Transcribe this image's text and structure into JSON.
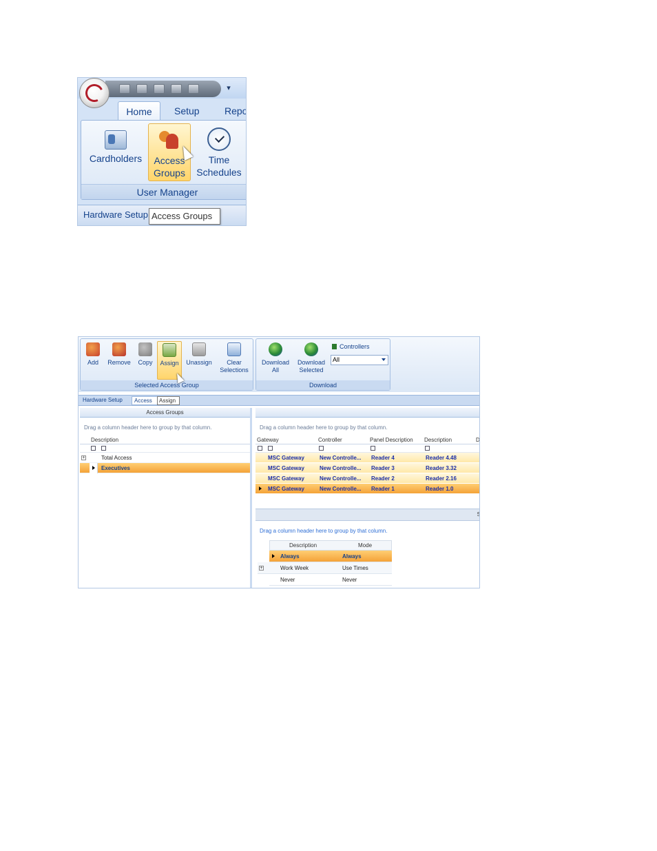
{
  "shot1": {
    "tabs": [
      "Home",
      "Setup",
      "Repo"
    ],
    "ribbon_buttons": [
      {
        "label_line1": "Cardholders",
        "label_line2": "",
        "icon": "cardholders-icon"
      },
      {
        "label_line1": "Access",
        "label_line2": "Groups",
        "icon": "people-icon"
      },
      {
        "label_line1": "Time",
        "label_line2": "Schedules",
        "icon": "clock-icon"
      }
    ],
    "group_label": "User Manager",
    "doc_tab": "Hardware Setup",
    "tooltip": "Access Groups"
  },
  "shot2": {
    "selected_group": {
      "label": "Selected Access Group",
      "buttons": [
        {
          "label_line1": "Add",
          "label_line2": ""
        },
        {
          "label_line1": "Remove",
          "label_line2": ""
        },
        {
          "label_line1": "Copy",
          "label_line2": ""
        },
        {
          "label_line1": "Assign",
          "label_line2": ""
        },
        {
          "label_line1": "Unassign",
          "label_line2": ""
        },
        {
          "label_line1": "Clear",
          "label_line2": "Selections"
        }
      ]
    },
    "download_group": {
      "label": "Download",
      "buttons": [
        {
          "label_line1": "Download",
          "label_line2": "All"
        },
        {
          "label_line1": "Download",
          "label_line2": "Selected"
        }
      ],
      "controllers_label": "Controllers",
      "controllers_value": "All"
    },
    "doc_tabs": {
      "hardware": "Hardware Setup",
      "access": "Access Groups",
      "tooltip": "Assign"
    },
    "left_pane": {
      "title": "Access Groups",
      "drag_hint": "Drag a column header here to group by that column.",
      "column": "Description",
      "rows": [
        "Total Access",
        "Executives"
      ]
    },
    "right_pane": {
      "drag_hint": "Drag a column header here to group by that column.",
      "columns": [
        "Gateway",
        "Controller",
        "Panel Description",
        "Description",
        "D"
      ],
      "rows": [
        [
          "MSC Gateway",
          "New Controlle...",
          "Reader 4",
          "Reader 4.48"
        ],
        [
          "MSC Gateway",
          "New Controlle...",
          "Reader 3",
          "Reader 3.32"
        ],
        [
          "MSC Gateway",
          "New Controlle...",
          "Reader 2",
          "Reader 2.16"
        ],
        [
          "MSC Gateway",
          "New Controlle...",
          "Reader 1",
          "Reader 1.0"
        ]
      ],
      "splitter_glyph": "S",
      "drag_hint2": "Drag a column header here to group by that column.",
      "mode_columns": [
        "Description",
        "Mode"
      ],
      "mode_rows": [
        [
          "Always",
          "Always"
        ],
        [
          "Work Week",
          "Use Times"
        ],
        [
          "Never",
          "Never"
        ]
      ]
    }
  },
  "colors": {
    "ribbon_text": "#15428b",
    "selection_orange": "#f4a238",
    "row_highlight": "#ffe8a8"
  }
}
